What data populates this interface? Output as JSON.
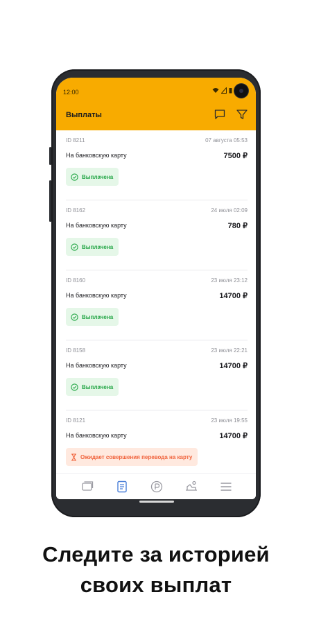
{
  "status_bar": {
    "time": "12:00"
  },
  "header": {
    "title": "Выплаты",
    "chat_icon": "chat-bubble-icon",
    "filter_icon": "filter-icon",
    "accent": "#f8ab00"
  },
  "payouts": [
    {
      "id": "ID 8211",
      "date": "07 августа 05:53",
      "method": "На банковскую карту",
      "amount": "7500 ₽",
      "status": "Выплачена",
      "status_kind": "paid"
    },
    {
      "id": "ID 8162",
      "date": "24 июля 02:09",
      "method": "На банковскую карту",
      "amount": "780 ₽",
      "status": "Выплачена",
      "status_kind": "paid"
    },
    {
      "id": "ID 8160",
      "date": "23 июля 23:12",
      "method": "На банковскую карту",
      "amount": "14700 ₽",
      "status": "Выплачена",
      "status_kind": "paid"
    },
    {
      "id": "ID 8158",
      "date": "23 июля 22:21",
      "method": "На банковскую карту",
      "amount": "14700 ₽",
      "status": "Выплачена",
      "status_kind": "paid"
    },
    {
      "id": "ID 8121",
      "date": "23 июля 19:55",
      "method": "На банковскую карту",
      "amount": "14700 ₽",
      "status": "Ожидает совершения перевода на карту",
      "status_kind": "pending"
    }
  ],
  "bottom_nav": {
    "items": [
      {
        "icon": "orders-icon",
        "active": false
      },
      {
        "icon": "payouts-list-icon",
        "active": true
      },
      {
        "icon": "balance-icon",
        "active": false
      },
      {
        "icon": "delivery-icon",
        "active": false
      },
      {
        "icon": "menu-icon",
        "active": false
      }
    ],
    "active_color": "#4a7fd8"
  },
  "caption": {
    "line1": "Следите за историей",
    "line2": "своих выплат"
  }
}
